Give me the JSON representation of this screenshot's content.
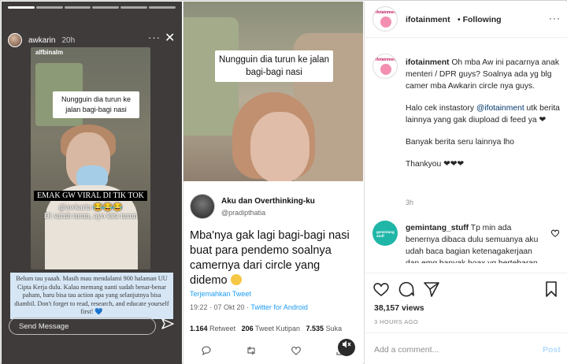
{
  "story": {
    "username": "awkarin",
    "time": "20h",
    "more_label": "···",
    "close_label": "✕",
    "sticker_text": "alfbinalm",
    "caption": "Nungguin dia turun ke jalan bagi-bagi nasi",
    "viral_line1": "EMAK GW VIRAL DI TIK TOK",
    "viral_line2": "@awkarin 😂😂😂",
    "viral_line3": "Di suruh turun, ayo kita turun",
    "long_text": "Belum tau yaaah. Masih mau mendalami 900 halaman UU Cipta Kerja dulu. Kalau memang nanti sudah benar-benar paham, baru bisa tau action apa yang selanjutnya bisa diambil. Don't forget to read, research, and educate yourself first! 💙",
    "send_placeholder": "Send Message"
  },
  "tweet": {
    "video_caption": "Nungguin dia turun ke jalan bagi-bagi nasi",
    "author_name": "Aku dan Overthinking-ku",
    "author_handle": "@pradipthatia",
    "body": "Mba'nya gak lagi bagi-bagi nasi buat para pendemo soalnya camernya dari circle yang didemo",
    "translate": "Terjemahkan Tweet",
    "time": "19:22 · 07 Okt 20 · ",
    "source": "Twitter for Android",
    "retweets": "1.164",
    "retweets_label": "Retweet",
    "quotes": "206",
    "quotes_label": "Tweet Kutipan",
    "likes": "7.535",
    "likes_label": "Suka"
  },
  "ig": {
    "username": "ifotainment",
    "follow_state": "• Following",
    "more_label": "···",
    "logo_text": "ifotainment",
    "caption_user": "ifotainment",
    "caption_p1": "Oh mba Aw ini pacarnya anak menteri / DPR guys? Soalnya ada yg blg camer mba Awkarin circle nya guys.",
    "caption_p2_pre": "Halo cek instastory ",
    "caption_p2_mention": "@ifotainment",
    "caption_p2_post": " utk berita lainnya yang gak diupload di feed ya ❤",
    "caption_p3": "Banyak berita seru lainnya lho",
    "caption_p4": "Thankyou ❤❤❤",
    "caption_age": "3h",
    "comment_user": "gemintang_stuff",
    "comment_avatar_text": "gemintang stuff",
    "comment_text": "Tp min ada benernya dibaca dulu semuanya aku udah baca bagian ketenagakerjaan dan emg banyak hoax yg bertebaran. Jadi memang",
    "views": "38,157 views",
    "posted": "3 HOURS AGO",
    "comment_placeholder": "Add a comment...",
    "post_label": "Post"
  }
}
